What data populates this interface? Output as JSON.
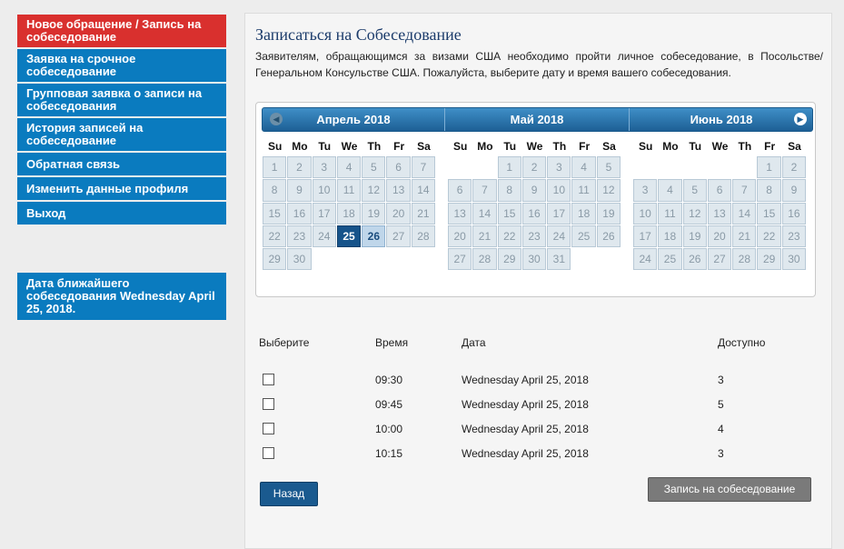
{
  "sidebar": {
    "items": [
      {
        "label": "Новое обращение / Запись на собеседование",
        "active": true
      },
      {
        "label": "Заявка на срочное собеседование",
        "active": false
      },
      {
        "label": "Групповая заявка о записи на собеседования",
        "active": false
      },
      {
        "label": "История записей на собеседование",
        "active": false
      },
      {
        "label": "Обратная связь",
        "active": false
      },
      {
        "label": "Изменить данные профиля",
        "active": false
      },
      {
        "label": "Выход",
        "active": false
      }
    ],
    "next_interview": "Дата ближайшего собеседования Wednesday April 25, 2018."
  },
  "main": {
    "title": "Записаться на Собеседование",
    "intro": "Заявителям, обращающимся за визами США необходимо пройти личное собеседование, в Посольстве/Генеральном Консульстве США. Пожалуйста, выберите дату и время вашего собеседования."
  },
  "calendar": {
    "weekdays": [
      "Su",
      "Mo",
      "Tu",
      "We",
      "Th",
      "Fr",
      "Sa"
    ],
    "prev_icon": "circle-arrow-left-icon",
    "next_icon": "circle-arrow-right-icon",
    "months": [
      {
        "title": "Апрель 2018",
        "first_weekday": 0,
        "days": 30,
        "selected": 25,
        "available": [
          26
        ]
      },
      {
        "title": "Май 2018",
        "first_weekday": 2,
        "days": 31,
        "selected": null,
        "available": []
      },
      {
        "title": "Июнь 2018",
        "first_weekday": 5,
        "days": 30,
        "selected": null,
        "available": []
      }
    ]
  },
  "slots": {
    "headers": {
      "select": "Выберите",
      "time": "Время",
      "date": "Дата",
      "available": "Доступно"
    },
    "rows": [
      {
        "time": "09:30",
        "date": "Wednesday April 25, 2018",
        "available": "3"
      },
      {
        "time": "09:45",
        "date": "Wednesday April 25, 2018",
        "available": "5"
      },
      {
        "time": "10:00",
        "date": "Wednesday April 25, 2018",
        "available": "4"
      },
      {
        "time": "10:15",
        "date": "Wednesday April 25, 2018",
        "available": "3"
      }
    ]
  },
  "buttons": {
    "back": "Назад",
    "book": "Запись на собеседование"
  },
  "colors": {
    "nav": "#0a7bbf",
    "nav_active": "#d9302e",
    "selected_day": "#16538a",
    "book_button": "#7a7a7a"
  }
}
